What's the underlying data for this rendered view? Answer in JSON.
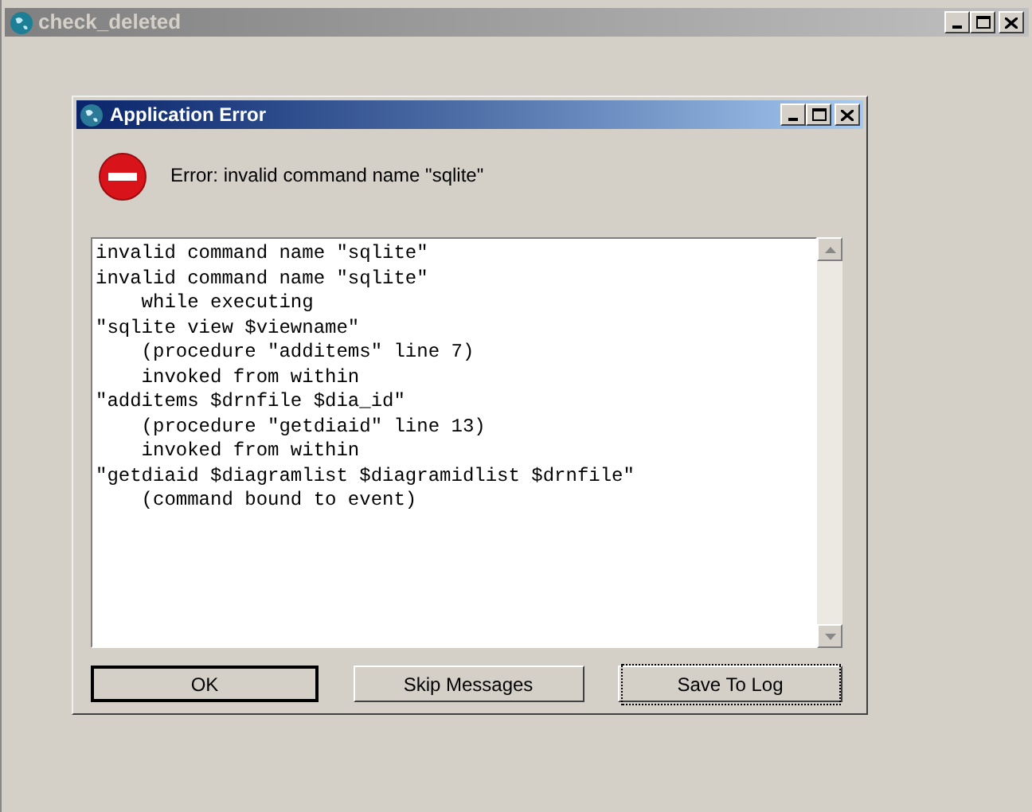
{
  "window": {
    "title": "check_deleted"
  },
  "dialog": {
    "title": "Application Error",
    "message": "Error: invalid command name \"sqlite\"",
    "details": [
      "invalid command name \"sqlite\"",
      "invalid command name \"sqlite\"",
      "    while executing",
      "\"sqlite view $viewname\"",
      "    (procedure \"additems\" line 7)",
      "    invoked from within",
      "\"additems $drnfile $dia_id\"",
      "    (procedure \"getdiaid\" line 13)",
      "    invoked from within",
      "\"getdiaid $diagramlist $diagramidlist $drnfile\"",
      "    (command bound to event)"
    ],
    "buttons": [
      {
        "label": "OK",
        "default": true,
        "focused": false
      },
      {
        "label": "Skip Messages",
        "default": false,
        "focused": false
      },
      {
        "label": "Save To Log",
        "default": false,
        "focused": true
      }
    ]
  }
}
